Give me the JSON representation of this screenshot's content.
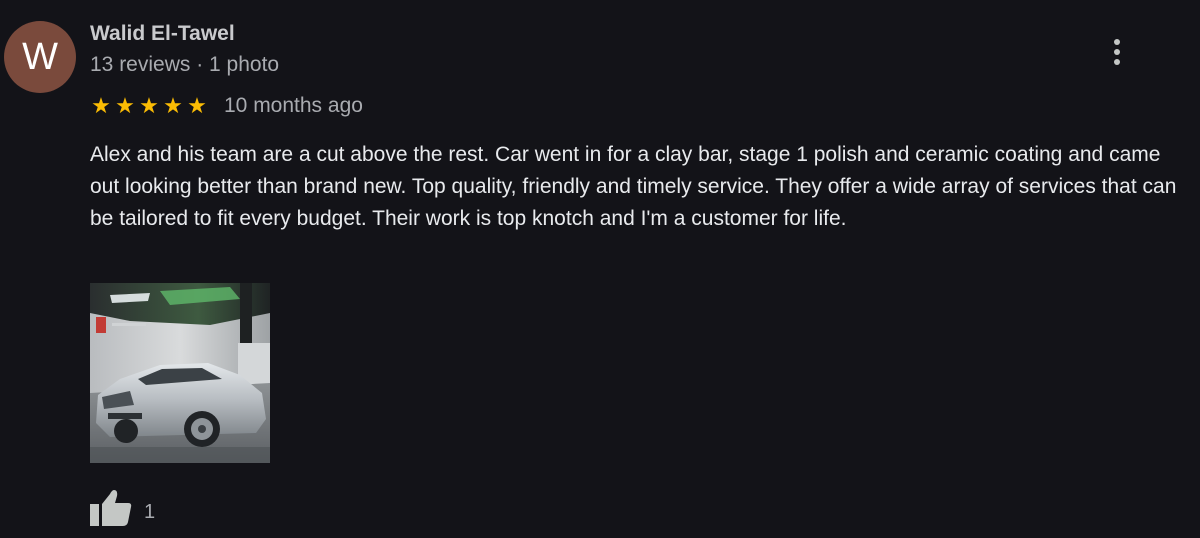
{
  "reviewer": {
    "initial": "W",
    "name": "Walid El-Tawel",
    "meta": "13 reviews · 1 photo",
    "avatar_color": "#7a4a3c"
  },
  "review": {
    "rating": 5,
    "rating_max": 5,
    "stars": [
      "★",
      "★",
      "★",
      "★",
      "★"
    ],
    "star_color": "#fbbc04",
    "date": "10 months ago",
    "text": "Alex and his team are a cut above the rest. Car went in for a clay bar, stage 1 polish and ceramic coating and came out looking better than brand new. Top quality, friendly and timely service. They offer a wide array of services that can be tailored to fit every budget. Their work is top knotch and I'm a customer for life."
  },
  "photo": {
    "subject": "silver sedan in detailing garage"
  },
  "actions": {
    "more_icon": "more-vert-icon",
    "like_icon": "thumbs-up-icon",
    "like_count": "1"
  }
}
